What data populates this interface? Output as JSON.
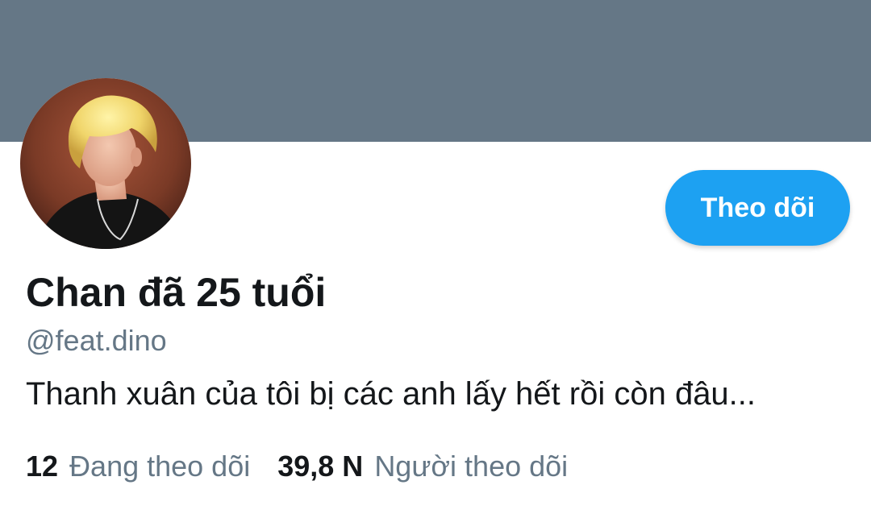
{
  "profile": {
    "display_name": "Chan đã 25 tuổi",
    "handle": "@feat.dino",
    "bio": "Thanh xuân của tôi bị các anh lấy hết rồi còn đâu...",
    "follow_label": "Theo dõi"
  },
  "stats": {
    "following_count": "12",
    "following_label": "Đang theo dõi",
    "followers_count": "39,8 N",
    "followers_label": "Người theo dõi"
  },
  "colors": {
    "banner": "#657786",
    "accent": "#1da1f2",
    "text_primary": "#14171a",
    "text_secondary": "#657786"
  },
  "icons": {
    "avatar": "profile-photo"
  }
}
